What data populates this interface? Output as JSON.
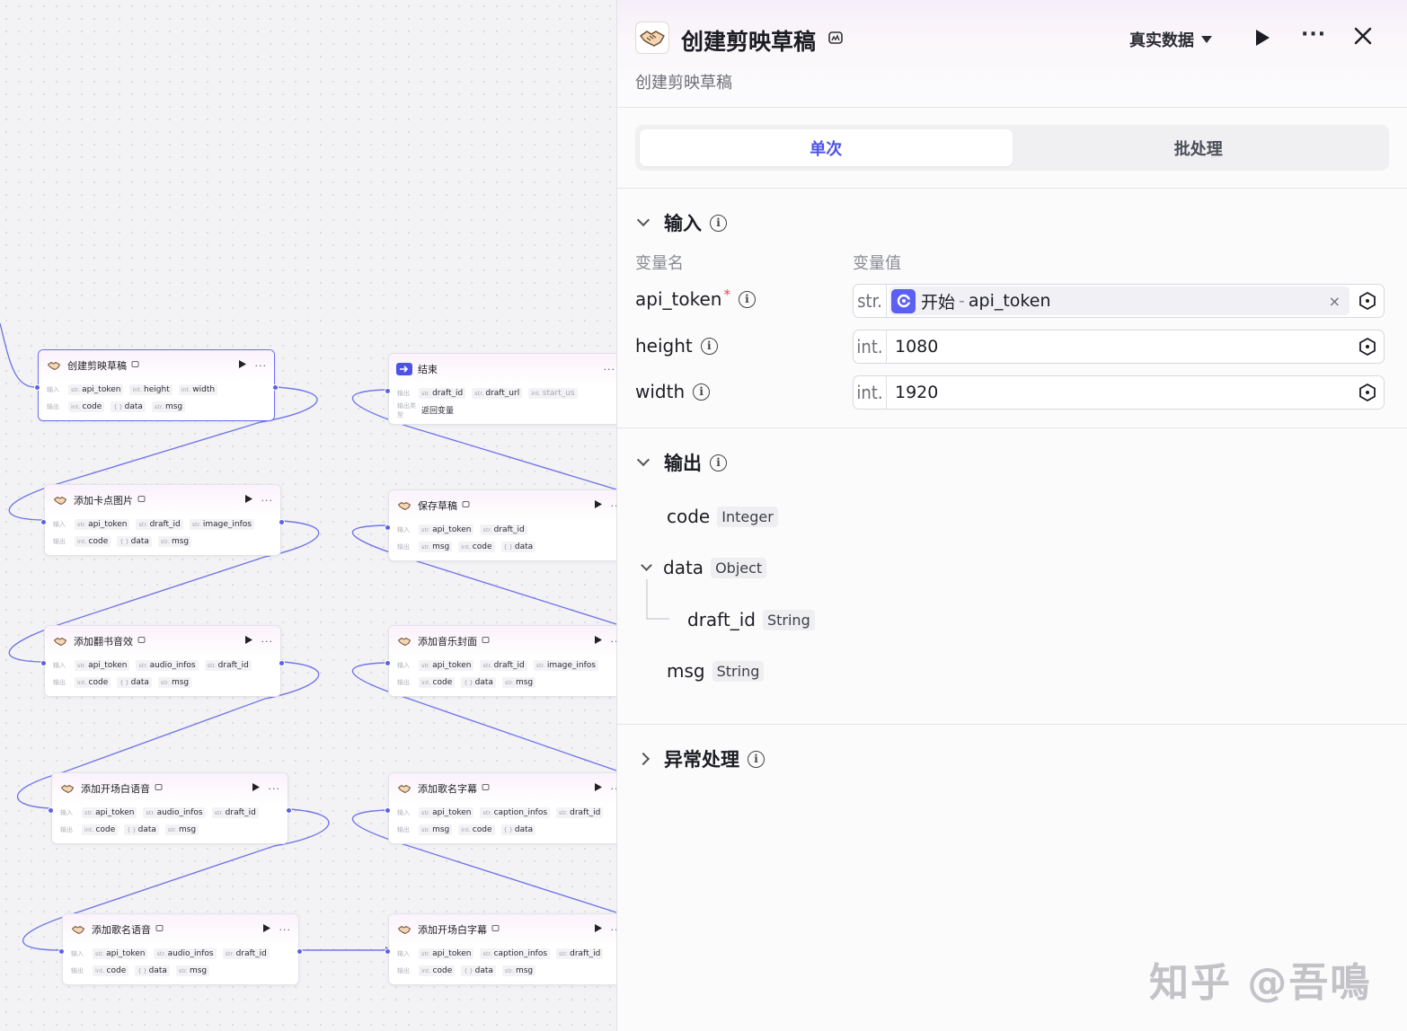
{
  "canvas": {
    "nodes": [
      {
        "id": "n1",
        "title": "创建剪映草稿",
        "in_label": "输入",
        "out_label": "输出",
        "inputs": [
          {
            "t": "str.",
            "n": "api_token"
          },
          {
            "t": "int.",
            "n": "height"
          },
          {
            "t": "int.",
            "n": "width"
          }
        ],
        "outputs": [
          {
            "t": "int.",
            "n": "code"
          },
          {
            "t": "{ }",
            "n": "data"
          },
          {
            "t": "str.",
            "n": "msg"
          }
        ]
      },
      {
        "id": "n2",
        "title": "添加卡点图片",
        "in_label": "输入",
        "out_label": "输出",
        "inputs": [
          {
            "t": "str.",
            "n": "api_token"
          },
          {
            "t": "str.",
            "n": "draft_id"
          },
          {
            "t": "str.",
            "n": "image_infos"
          }
        ],
        "outputs": [
          {
            "t": "int.",
            "n": "code"
          },
          {
            "t": "{ }",
            "n": "data"
          },
          {
            "t": "str.",
            "n": "msg"
          }
        ]
      },
      {
        "id": "n3",
        "title": "添加翻书音效",
        "in_label": "输入",
        "out_label": "输出",
        "inputs": [
          {
            "t": "str.",
            "n": "api_token"
          },
          {
            "t": "str.",
            "n": "audio_infos"
          },
          {
            "t": "str.",
            "n": "draft_id"
          }
        ],
        "outputs": [
          {
            "t": "int.",
            "n": "code"
          },
          {
            "t": "{ }",
            "n": "data"
          },
          {
            "t": "str.",
            "n": "msg"
          }
        ]
      },
      {
        "id": "n4",
        "title": "添加开场白语音",
        "in_label": "输入",
        "out_label": "输出",
        "inputs": [
          {
            "t": "str.",
            "n": "api_token"
          },
          {
            "t": "str.",
            "n": "audio_infos"
          },
          {
            "t": "str.",
            "n": "draft_id"
          }
        ],
        "outputs": [
          {
            "t": "int.",
            "n": "code"
          },
          {
            "t": "{ }",
            "n": "data"
          },
          {
            "t": "str.",
            "n": "msg"
          }
        ]
      },
      {
        "id": "n5",
        "title": "添加歌名语音",
        "in_label": "输入",
        "out_label": "输出",
        "inputs": [
          {
            "t": "str.",
            "n": "api_token"
          },
          {
            "t": "str.",
            "n": "audio_infos"
          },
          {
            "t": "str.",
            "n": "draft_id"
          }
        ],
        "outputs": [
          {
            "t": "int.",
            "n": "code"
          },
          {
            "t": "{ }",
            "n": "data"
          },
          {
            "t": "str.",
            "n": "msg"
          }
        ]
      },
      {
        "id": "n6",
        "title": "结束",
        "in_label": "输出",
        "out_label": "输出类型",
        "inputs": [
          {
            "t": "str.",
            "n": "draft_id"
          },
          {
            "t": "str.",
            "n": "draft_url"
          },
          {
            "t": "int.",
            "n": "start_us"
          }
        ],
        "outputs": [
          {
            "t": "",
            "n": "返回变量"
          }
        ]
      },
      {
        "id": "n7",
        "title": "保存草稿",
        "in_label": "输入",
        "out_label": "输出",
        "inputs": [
          {
            "t": "str.",
            "n": "api_token"
          },
          {
            "t": "str.",
            "n": "draft_id"
          }
        ],
        "outputs": [
          {
            "t": "str.",
            "n": "msg"
          },
          {
            "t": "int.",
            "n": "code"
          },
          {
            "t": "{ }",
            "n": "data"
          }
        ]
      },
      {
        "id": "n8",
        "title": "添加音乐封面",
        "in_label": "输入",
        "out_label": "输出",
        "inputs": [
          {
            "t": "str.",
            "n": "api_token"
          },
          {
            "t": "str.",
            "n": "draft_id"
          },
          {
            "t": "str.",
            "n": "image_infos"
          }
        ],
        "outputs": [
          {
            "t": "int.",
            "n": "code"
          },
          {
            "t": "{ }",
            "n": "data"
          },
          {
            "t": "str.",
            "n": "msg"
          }
        ]
      },
      {
        "id": "n9",
        "title": "添加歌名字幕",
        "in_label": "输入",
        "out_label": "输出",
        "inputs": [
          {
            "t": "str.",
            "n": "api_token"
          },
          {
            "t": "str.",
            "n": "caption_infos"
          },
          {
            "t": "str.",
            "n": "draft_id"
          }
        ],
        "outputs": [
          {
            "t": "str.",
            "n": "msg"
          },
          {
            "t": "int.",
            "n": "code"
          },
          {
            "t": "{ }",
            "n": "data"
          }
        ]
      },
      {
        "id": "n10",
        "title": "添加开场白字幕",
        "in_label": "输入",
        "out_label": "输出",
        "inputs": [
          {
            "t": "str.",
            "n": "api_token"
          },
          {
            "t": "str.",
            "n": "caption_infos"
          },
          {
            "t": "str.",
            "n": "draft_id"
          }
        ],
        "outputs": [
          {
            "t": "int.",
            "n": "code"
          },
          {
            "t": "{ }",
            "n": "data"
          },
          {
            "t": "str.",
            "n": "msg"
          }
        ]
      }
    ]
  },
  "panel": {
    "title": "创建剪映草稿",
    "description": "创建剪映草稿",
    "data_mode": "真实数据",
    "more": "···",
    "tabs": [
      {
        "label": "单次",
        "active": true
      },
      {
        "label": "批处理",
        "active": false
      }
    ],
    "input_section": {
      "title": "输入",
      "col_name": "变量名",
      "col_value": "变量值",
      "vars": [
        {
          "name": "api_token",
          "required_mark": "*",
          "type": "str.",
          "ref_source": "开始",
          "ref_sep": "-",
          "ref_var": "api_token",
          "clear": "×"
        },
        {
          "name": "height",
          "type": "int.",
          "value": "1080"
        },
        {
          "name": "width",
          "type": "int.",
          "value": "1920"
        }
      ]
    },
    "output_section": {
      "title": "输出",
      "items": [
        {
          "name": "code",
          "type": "Integer"
        },
        {
          "name": "data",
          "type": "Object"
        },
        {
          "name": "draft_id",
          "type": "String"
        },
        {
          "name": "msg",
          "type": "String"
        }
      ]
    },
    "error_section": {
      "title": "异常处理"
    }
  },
  "colors": {
    "accent": "#4d53e8",
    "edge": "#5d61e6",
    "required": "#e5484d"
  },
  "watermark": "知乎 @吾鳴"
}
